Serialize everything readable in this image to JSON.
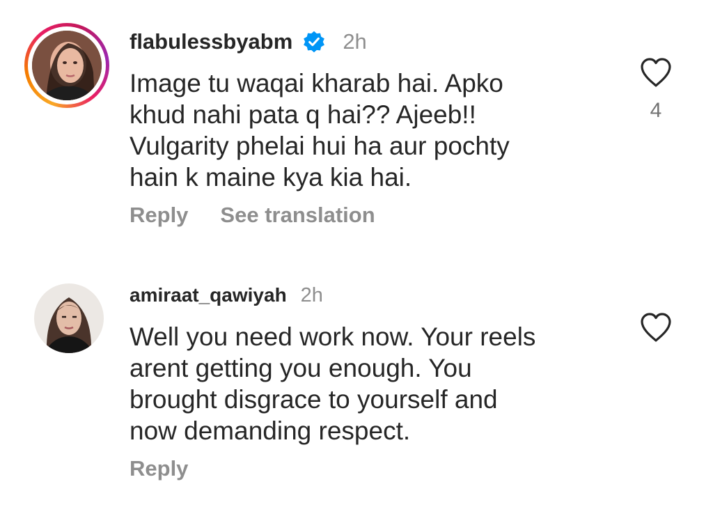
{
  "comments": [
    {
      "username": "flabulessbyabm",
      "verified": true,
      "time": "2h",
      "text": "Image tu waqai kharab hai. Apko\nkhud nahi pata q hai?? Ajeeb!!\nVulgarity phelai hui ha aur pochty\nhain k maine kya kia hai.",
      "reply_label": "Reply",
      "translate_label": "See translation",
      "like_count": "4"
    },
    {
      "username": "amiraat_qawiyah",
      "verified": false,
      "time": "2h",
      "text": "Well you need work now. Your reels\narent getting you enough. You\nbrought disgrace to yourself and\nnow demanding respect.",
      "reply_label": "Reply"
    }
  ],
  "colors": {
    "text": "#262626",
    "secondary": "#8e8e8e",
    "verified_badge": "#0095f6"
  },
  "icons": {
    "like": "heart-outline-icon",
    "verified": "verified-badge-icon"
  }
}
